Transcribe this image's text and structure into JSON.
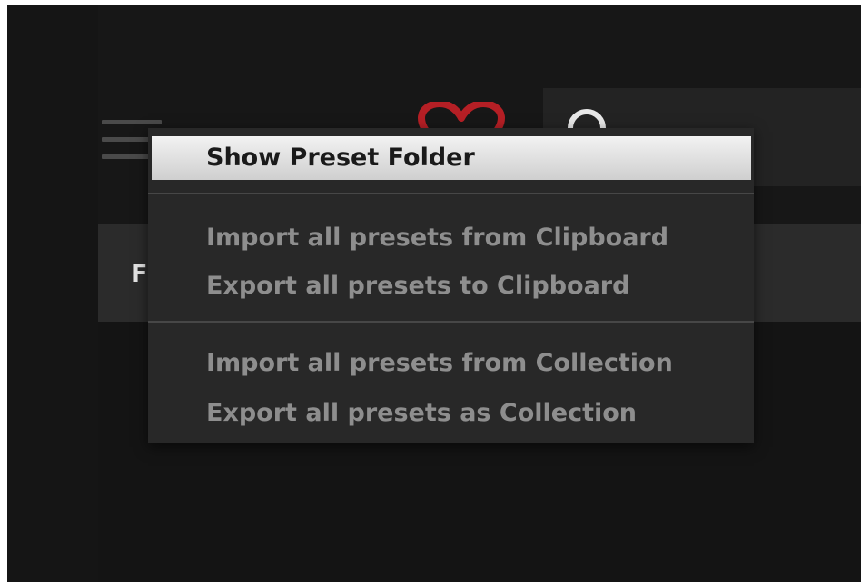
{
  "app": {
    "presets_header_label": "F"
  },
  "icons": {
    "menu": "hamburger-icon",
    "favorite": "heart-icon",
    "search": "search-icon"
  },
  "colors": {
    "background": "#171717",
    "menu_background": "#282828",
    "menu_text": "#8e8e8e",
    "highlight_text": "#1a1a1a",
    "heart": "#b51f25"
  },
  "context_menu": {
    "items": [
      {
        "label": "Show Preset Folder"
      },
      {
        "label": "Import all presets from Clipboard"
      },
      {
        "label": "Export all presets to Clipboard"
      },
      {
        "label": "Import all presets from Collection"
      },
      {
        "label": "Export all presets as Collection"
      }
    ]
  }
}
